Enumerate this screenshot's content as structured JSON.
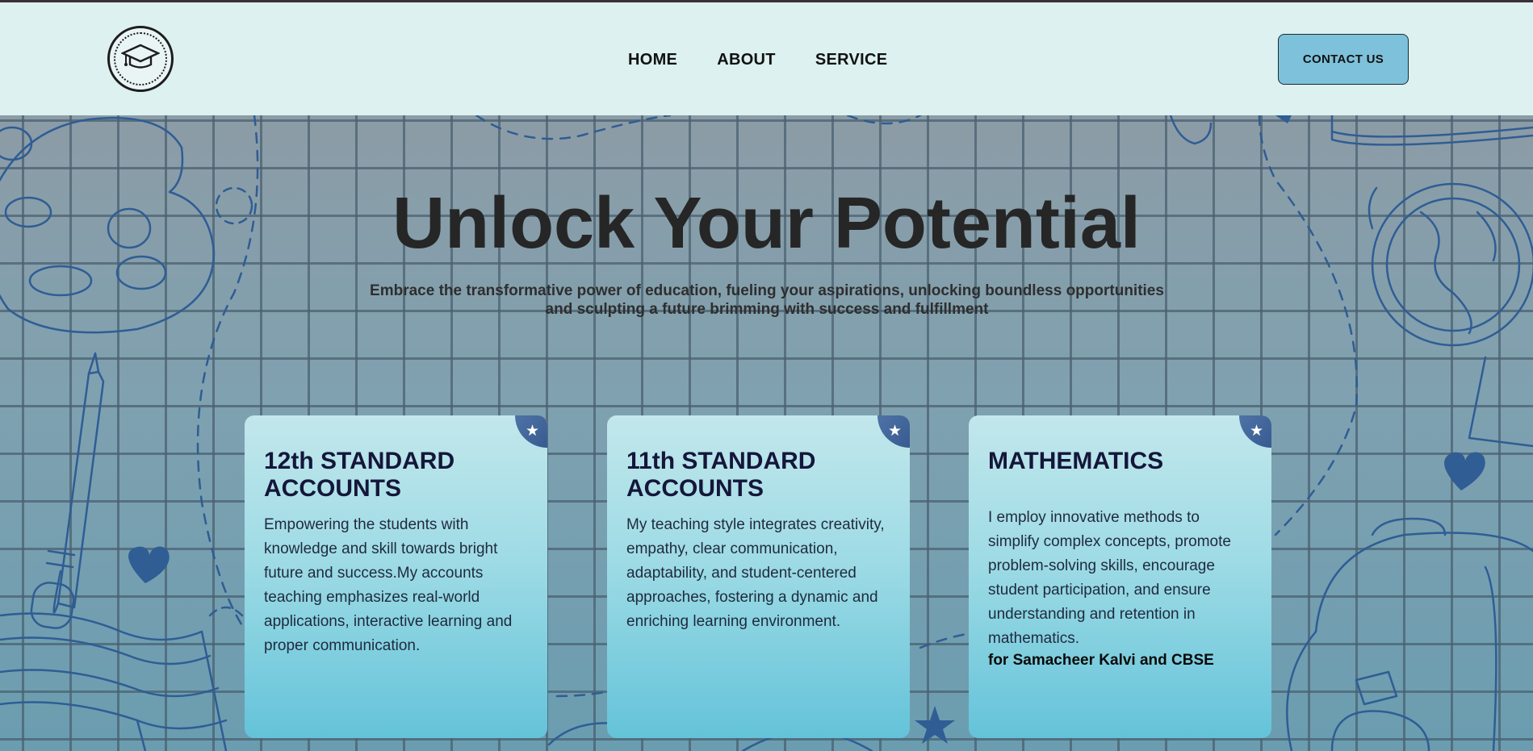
{
  "nav": {
    "links": [
      "HOME",
      "ABOUT",
      "SERVICE"
    ],
    "contact_label": "CONTACT US"
  },
  "hero": {
    "title": "Unlock Your Potential",
    "subtitle_line1": "Embrace the transformative power of education, fueling your aspirations, unlocking boundless opportunities",
    "subtitle_line2": "and sculpting a future brimming with success and fulfillment"
  },
  "cards": [
    {
      "title": "12th STANDARD ACCOUNTS",
      "text": "Empowering the students with knowledge and skill towards bright future and success.My accounts teaching emphasizes real-world applications, interactive learning and proper communication."
    },
    {
      "title": "11th STANDARD ACCOUNTS",
      "text": "My teaching style integrates creativity, empathy, clear communication, adaptability, and student-centered approaches, fostering a dynamic and enriching learning environment."
    },
    {
      "title": "MATHEMATICS",
      "text": "I employ innovative methods to simplify complex concepts, promote problem-solving skills, encourage student participation, and ensure understanding and retention in mathematics.",
      "note": "for Samacheer Kalvi and CBSE"
    }
  ],
  "icons": {
    "logo": "graduation-cap-icon",
    "card_badge": "star-icon"
  },
  "colors": {
    "navbar_bg": "#dcf1f0",
    "contact_button_bg": "#7ec1da",
    "doodle_stroke": "#2f5d94",
    "badge": "#2c4f86"
  }
}
